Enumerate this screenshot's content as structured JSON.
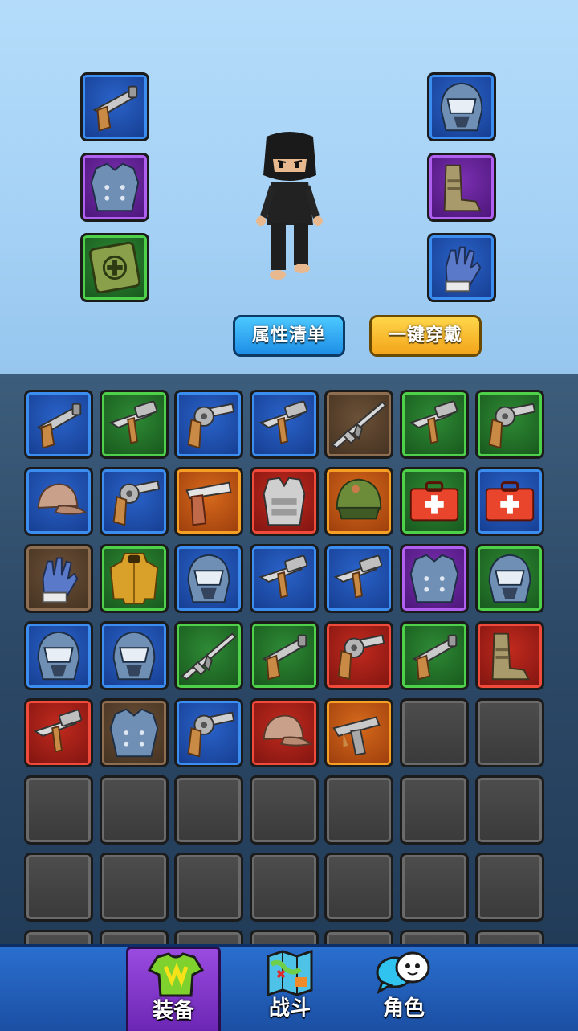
{
  "equipped": {
    "left": [
      {
        "rarity": "blue",
        "icon": "flare-gun-icon",
        "slot": "weapon"
      },
      {
        "rarity": "purple",
        "icon": "body-armor-icon",
        "slot": "armor"
      },
      {
        "rarity": "green",
        "icon": "medkit-box-icon",
        "slot": "supply"
      }
    ],
    "right": [
      {
        "rarity": "blue",
        "icon": "helmet-icon",
        "slot": "head"
      },
      {
        "rarity": "purple",
        "icon": "boots-icon",
        "slot": "feet"
      },
      {
        "rarity": "blue",
        "icon": "glove-icon",
        "slot": "hands"
      }
    ]
  },
  "buttons": {
    "attributes": "属性清单",
    "quick_equip": "一键穿戴"
  },
  "inventory": [
    {
      "rarity": "blue",
      "icon": "flare-gun-icon"
    },
    {
      "rarity": "green",
      "icon": "smg-icon"
    },
    {
      "rarity": "blue",
      "icon": "revolver-icon"
    },
    {
      "rarity": "blue",
      "icon": "smg-icon"
    },
    {
      "rarity": "brown",
      "icon": "rifle-icon"
    },
    {
      "rarity": "green",
      "icon": "smg-icon"
    },
    {
      "rarity": "green",
      "icon": "revolver-icon"
    },
    {
      "rarity": "blue",
      "icon": "cap-icon"
    },
    {
      "rarity": "blue",
      "icon": "revolver-icon"
    },
    {
      "rarity": "orange",
      "icon": "pistol-icon"
    },
    {
      "rarity": "red",
      "icon": "vest-icon"
    },
    {
      "rarity": "orange",
      "icon": "combat-helmet-icon"
    },
    {
      "rarity": "green",
      "icon": "medkit-icon"
    },
    {
      "rarity": "blue",
      "icon": "medkit-icon"
    },
    {
      "rarity": "brown",
      "icon": "glove-icon"
    },
    {
      "rarity": "green",
      "icon": "jacket-icon"
    },
    {
      "rarity": "blue",
      "icon": "helmet-icon"
    },
    {
      "rarity": "blue",
      "icon": "smg-icon"
    },
    {
      "rarity": "blue",
      "icon": "smg-icon"
    },
    {
      "rarity": "purple",
      "icon": "body-armor-icon"
    },
    {
      "rarity": "green",
      "icon": "helmet-icon"
    },
    {
      "rarity": "blue",
      "icon": "helmet-icon"
    },
    {
      "rarity": "blue",
      "icon": "helmet-icon"
    },
    {
      "rarity": "green",
      "icon": "rifle-icon"
    },
    {
      "rarity": "green",
      "icon": "flare-gun-icon"
    },
    {
      "rarity": "red",
      "icon": "revolver-icon"
    },
    {
      "rarity": "green",
      "icon": "flare-gun-icon"
    },
    {
      "rarity": "red",
      "icon": "boots-icon"
    },
    {
      "rarity": "red",
      "icon": "smg-icon"
    },
    {
      "rarity": "brown",
      "icon": "body-armor-icon"
    },
    {
      "rarity": "blue",
      "icon": "revolver-icon"
    },
    {
      "rarity": "red",
      "icon": "cap-icon"
    },
    {
      "rarity": "orange",
      "icon": "uzi-icon"
    },
    {
      "rarity": "empty",
      "icon": ""
    },
    {
      "rarity": "empty",
      "icon": ""
    },
    {
      "rarity": "empty",
      "icon": ""
    },
    {
      "rarity": "empty",
      "icon": ""
    },
    {
      "rarity": "empty",
      "icon": ""
    },
    {
      "rarity": "empty",
      "icon": ""
    },
    {
      "rarity": "empty",
      "icon": ""
    },
    {
      "rarity": "empty",
      "icon": ""
    },
    {
      "rarity": "empty",
      "icon": ""
    },
    {
      "rarity": "empty",
      "icon": ""
    },
    {
      "rarity": "empty",
      "icon": ""
    },
    {
      "rarity": "empty",
      "icon": ""
    },
    {
      "rarity": "empty",
      "icon": ""
    },
    {
      "rarity": "empty",
      "icon": ""
    },
    {
      "rarity": "empty",
      "icon": ""
    },
    {
      "rarity": "empty",
      "icon": ""
    },
    {
      "rarity": "empty",
      "icon": ""
    },
    {
      "rarity": "empty",
      "icon": ""
    },
    {
      "rarity": "empty",
      "icon": ""
    },
    {
      "rarity": "empty",
      "icon": ""
    },
    {
      "rarity": "empty",
      "icon": ""
    },
    {
      "rarity": "empty",
      "icon": ""
    },
    {
      "rarity": "empty",
      "icon": ""
    }
  ],
  "nav": {
    "tabs": [
      {
        "label": "装备",
        "icon": "shirt-icon",
        "active": true
      },
      {
        "label": "战斗",
        "icon": "map-icon",
        "active": false
      },
      {
        "label": "角色",
        "icon": "chat-bubbles-icon",
        "active": false
      }
    ]
  },
  "colors": {
    "sky": "#a6d2f6",
    "panel": "#2b4866",
    "nav": "#2a6fcf",
    "active_tab": "#9a4be0",
    "attr_button": "#1e8ee6",
    "equip_button": "#f3a41a"
  }
}
